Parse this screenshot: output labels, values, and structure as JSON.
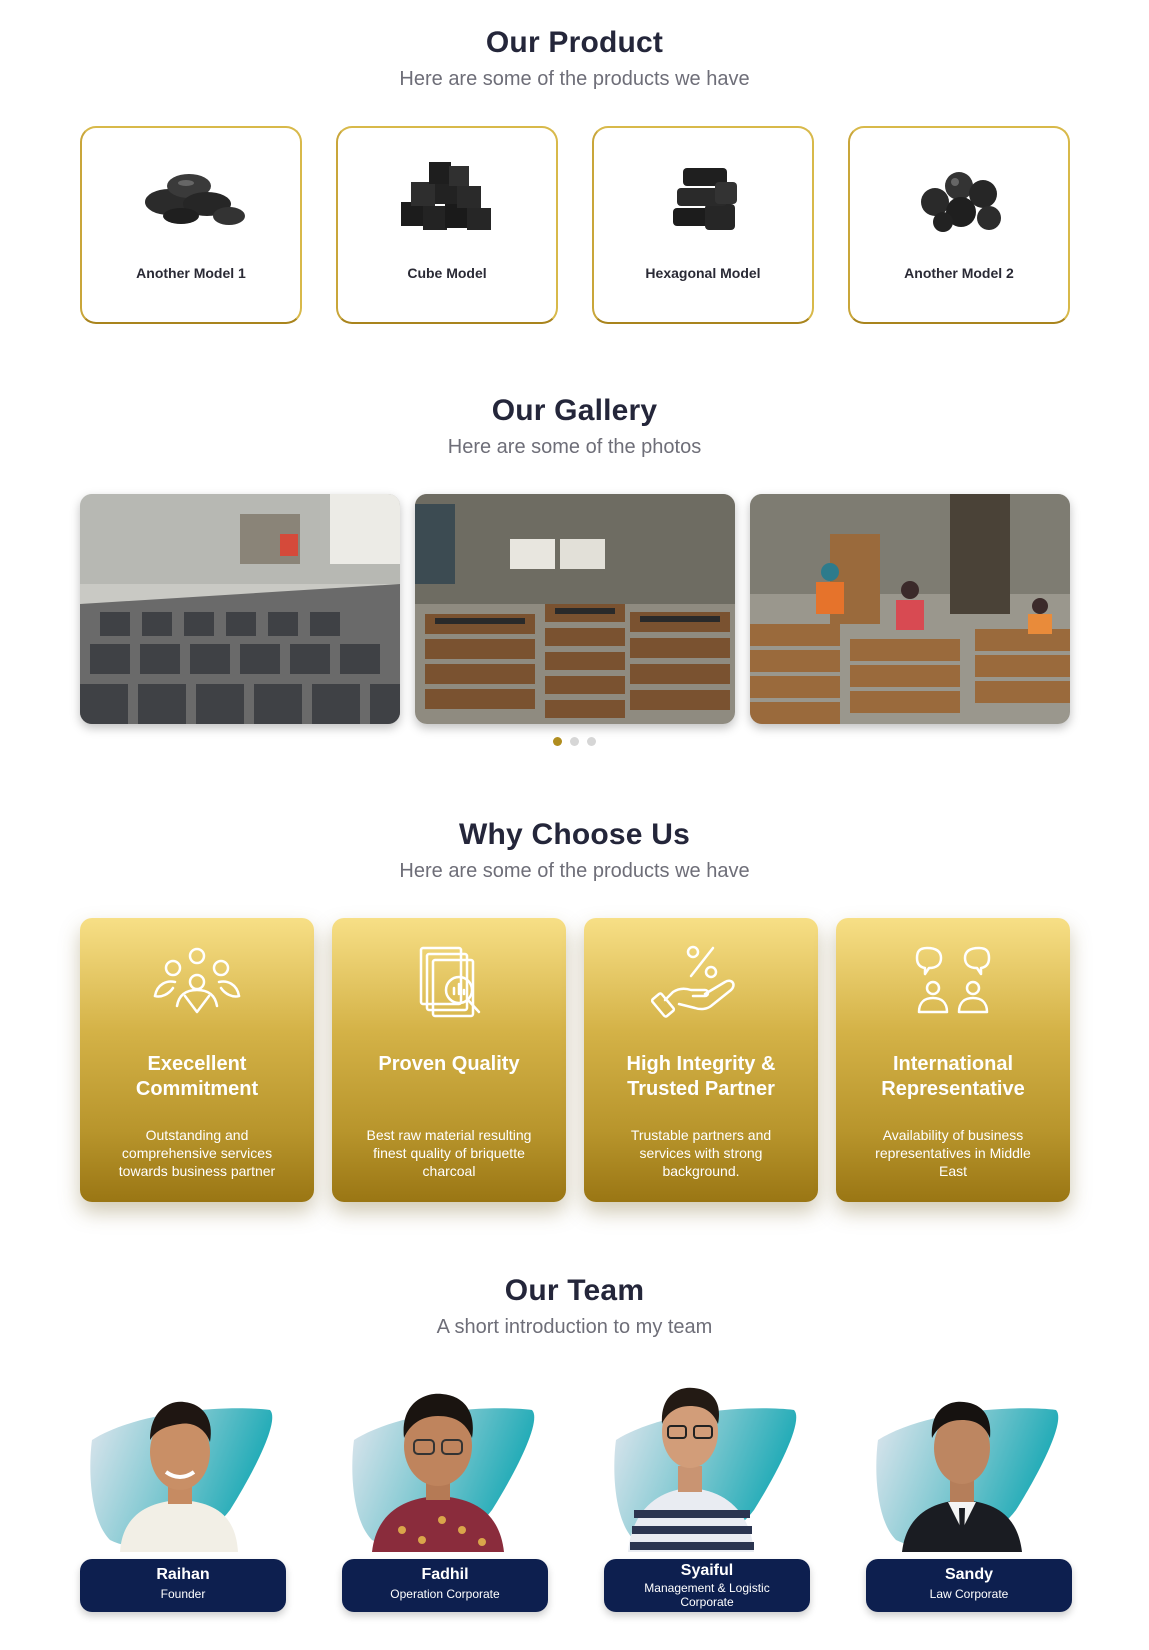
{
  "products_section": {
    "title": "Our Product",
    "subtitle": "Here are some of the products we have",
    "items": [
      {
        "name": "Another Model 1",
        "icon": "pillow-briquette-icon"
      },
      {
        "name": "Cube Model",
        "icon": "cube-briquette-icon"
      },
      {
        "name": "Hexagonal Model",
        "icon": "hexagonal-briquette-icon"
      },
      {
        "name": "Another Model 2",
        "icon": "round-briquette-icon"
      }
    ],
    "accent_color": "#d8b94a"
  },
  "gallery_section": {
    "title": "Our Gallery",
    "subtitle": "Here are some of the photos",
    "photos": 3,
    "active_dot": 1,
    "dots": 3
  },
  "why_section": {
    "title": "Why Choose Us",
    "subtitle": "Here are some of the products we have",
    "cards": [
      {
        "title": "Execellent Commitment",
        "description": "Outstanding and comprehensive services towards business partner",
        "icon": "team-people-icon"
      },
      {
        "title": "Proven Quality",
        "description": "Best raw material resulting finest quality of briquette charcoal",
        "icon": "document-analysis-icon"
      },
      {
        "title": "High Integrity & Trusted Partner",
        "description": "Trustable partners and services with strong background.",
        "icon": "hand-percent-icon"
      },
      {
        "title": "International Representative",
        "description": "Availability of business representatives in Middle East",
        "icon": "chat-people-icon"
      }
    ]
  },
  "team_section": {
    "title": "Our Team",
    "subtitle": "A short introduction to my team",
    "members": [
      {
        "name": "Raihan",
        "role": "Founder"
      },
      {
        "name": "Fadhil",
        "role": "Operation Corporate"
      },
      {
        "name": "Syaiful",
        "role": "Management & Logistic Corporate"
      },
      {
        "name": "Sandy",
        "role": "Law Corporate"
      }
    ],
    "nametag_color": "#0d1f4f"
  }
}
